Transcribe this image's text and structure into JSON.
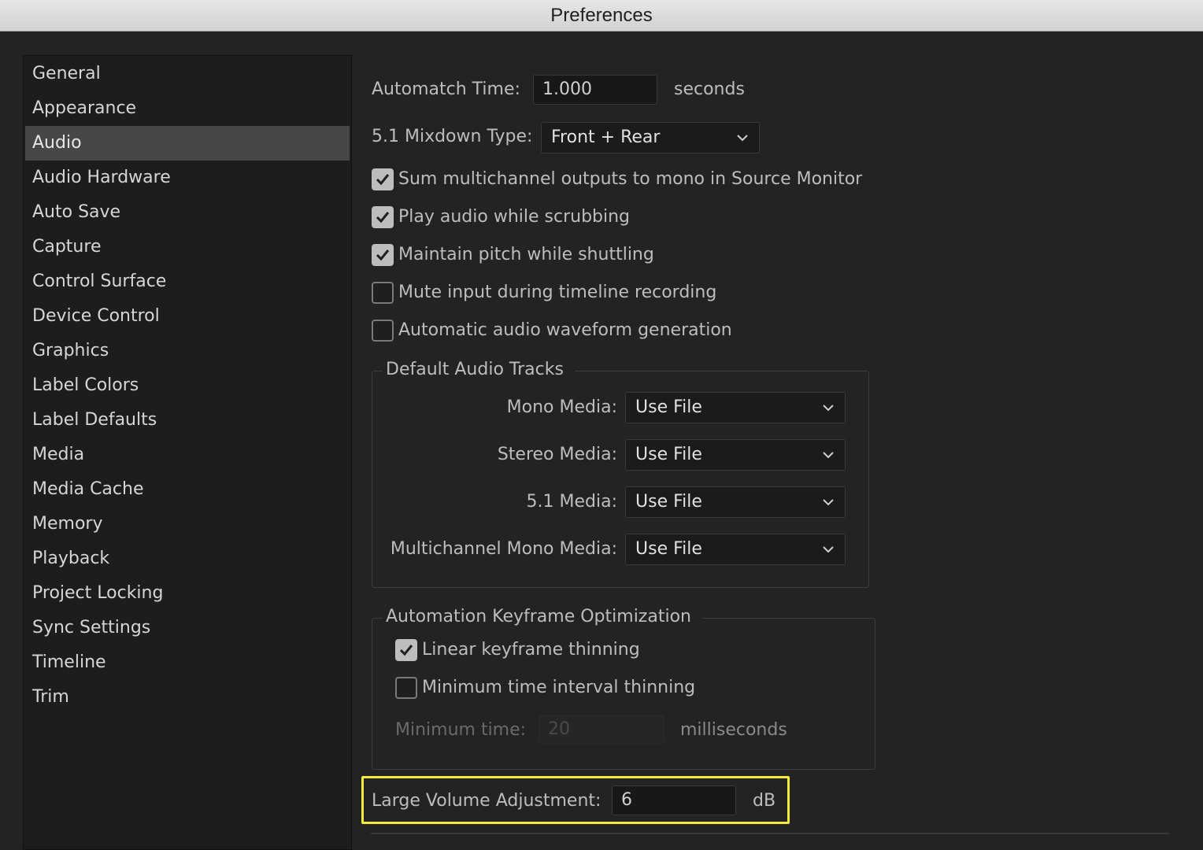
{
  "window": {
    "title": "Preferences"
  },
  "sidebar": {
    "items": [
      {
        "label": "General"
      },
      {
        "label": "Appearance"
      },
      {
        "label": "Audio",
        "selected": true
      },
      {
        "label": "Audio Hardware"
      },
      {
        "label": "Auto Save"
      },
      {
        "label": "Capture"
      },
      {
        "label": "Control Surface"
      },
      {
        "label": "Device Control"
      },
      {
        "label": "Graphics"
      },
      {
        "label": "Label Colors"
      },
      {
        "label": "Label Defaults"
      },
      {
        "label": "Media"
      },
      {
        "label": "Media Cache"
      },
      {
        "label": "Memory"
      },
      {
        "label": "Playback"
      },
      {
        "label": "Project Locking"
      },
      {
        "label": "Sync Settings"
      },
      {
        "label": "Timeline"
      },
      {
        "label": "Trim"
      }
    ]
  },
  "audio": {
    "automatch": {
      "label": "Automatch Time:",
      "value": "1.000",
      "unit": "seconds"
    },
    "mixdown": {
      "label": "5.1 Mixdown Type:",
      "value": "Front + Rear"
    },
    "checkboxes": [
      {
        "label": "Sum multichannel outputs to mono in Source Monitor",
        "checked": true
      },
      {
        "label": "Play audio while scrubbing",
        "checked": true
      },
      {
        "label": "Maintain pitch while shuttling",
        "checked": true
      },
      {
        "label": "Mute input during timeline recording",
        "checked": false
      },
      {
        "label": "Automatic audio waveform generation",
        "checked": false
      }
    ],
    "default_tracks": {
      "title": "Default Audio Tracks",
      "rows": [
        {
          "label": "Mono Media:",
          "value": "Use File"
        },
        {
          "label": "Stereo Media:",
          "value": "Use File"
        },
        {
          "label": "5.1 Media:",
          "value": "Use File"
        },
        {
          "label": "Multichannel Mono Media:",
          "value": "Use File"
        }
      ]
    },
    "keyframe_opt": {
      "title": "Automation Keyframe Optimization",
      "linear": {
        "label": "Linear keyframe thinning",
        "checked": true
      },
      "min_interval": {
        "label": "Minimum time interval thinning",
        "checked": false
      },
      "min_time": {
        "label": "Minimum time:",
        "value": "20",
        "unit": "milliseconds",
        "enabled": false
      }
    },
    "large_volume": {
      "label": "Large Volume Adjustment:",
      "value": "6",
      "unit": "dB"
    }
  },
  "colors": {
    "highlight": "#f4ec3a",
    "selected_bg": "#474747",
    "panel_bg": "#232323"
  }
}
